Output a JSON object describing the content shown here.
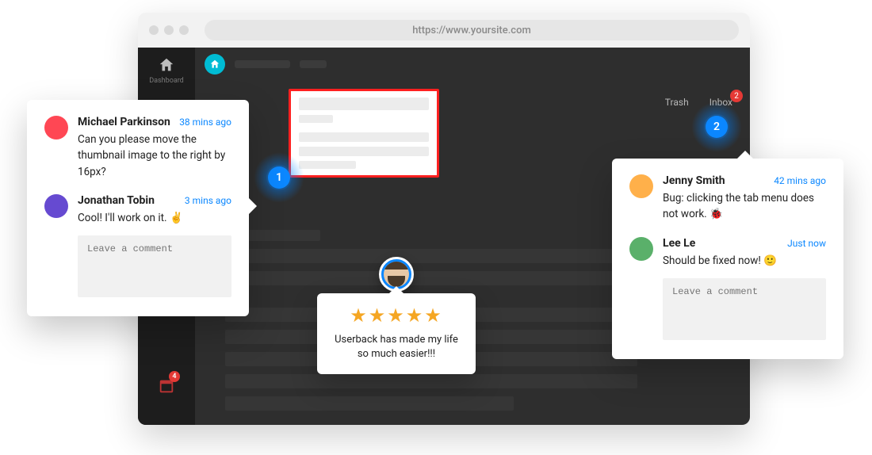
{
  "url": "https://www.yoursite.com",
  "sidebar": {
    "dashboard_label": "Dashboard",
    "calendar_badge": "4"
  },
  "header": {
    "trash_label": "Trash",
    "inbox_label": "Inbox",
    "inbox_count": "2"
  },
  "pins": {
    "one": "1",
    "two": "2"
  },
  "rating": {
    "stars": "★★★★★",
    "text": "Userback has made my life so much easier!!!"
  },
  "popup_left": {
    "comments": [
      {
        "name": "Michael Parkinson",
        "time": "38 mins ago",
        "body": "Can you please move the thumbnail image to the right by 16px?"
      },
      {
        "name": "Jonathan Tobin",
        "time": "3 mins ago",
        "body": "Cool! I'll work on it. ✌️"
      }
    ],
    "placeholder": "Leave a comment"
  },
  "popup_right": {
    "comments": [
      {
        "name": "Jenny Smith",
        "time": "42 mins ago",
        "body": "Bug: clicking the tab menu does not work. 🐞"
      },
      {
        "name": "Lee Le",
        "time": "Just now",
        "body": "Should be fixed now! 🙂"
      }
    ],
    "placeholder": "Leave a comment"
  }
}
